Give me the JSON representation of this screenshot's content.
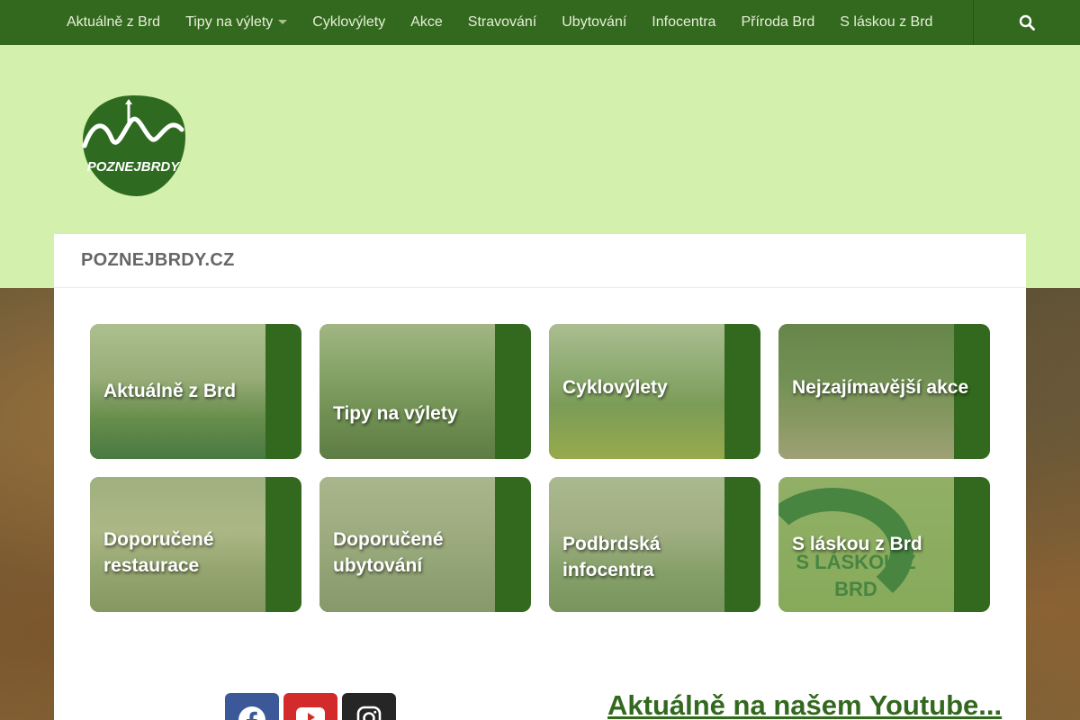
{
  "nav": {
    "items": [
      {
        "label": "Aktuálně z Brd"
      },
      {
        "label": "Tipy na výlety"
      },
      {
        "label": "Cyklovýlety"
      },
      {
        "label": "Akce"
      },
      {
        "label": "Stravování"
      },
      {
        "label": "Ubytování"
      },
      {
        "label": "Infocentra"
      },
      {
        "label": "Příroda Brd"
      },
      {
        "label": "S láskou z Brd"
      }
    ],
    "search_icon": "search-icon"
  },
  "header": {
    "logo_text": "POZNEJBRDY"
  },
  "site": {
    "title": "POZNEJBRDY.CZ"
  },
  "tiles": [
    {
      "label": "Aktuálně z Brd"
    },
    {
      "label": "Tipy na výlety"
    },
    {
      "label": "Cyklovýlety"
    },
    {
      "label": "Nejzajímavější akce"
    },
    {
      "label": "Doporučené restaurace"
    },
    {
      "label": "Doporučené ubytování"
    },
    {
      "label": "Podbrdská infocentra"
    },
    {
      "label": "S láskou z Brd"
    }
  ],
  "tile_art": {
    "s_laskou_text": "S LÁSKOU Z BRD"
  },
  "social": {
    "facebook_icon": "facebook-icon",
    "youtube_icon": "youtube-icon",
    "instagram_icon": "instagram-icon"
  },
  "youtube_section": {
    "heading": "Aktuálně na našem Youtube..."
  },
  "colors": {
    "nav_bg": "#33691e",
    "header_bg": "#d4f0ad",
    "accent": "#33691e",
    "facebook": "#3b5998",
    "youtube": "#d32b2b",
    "instagram": "#262626"
  }
}
